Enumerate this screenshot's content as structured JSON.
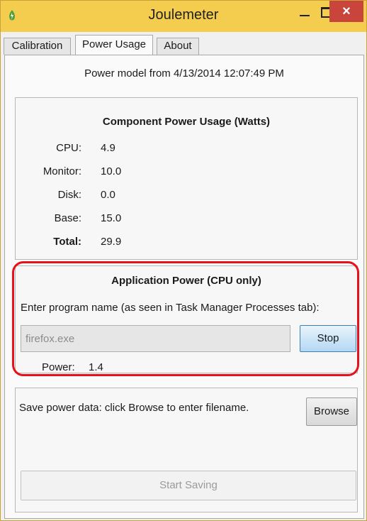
{
  "window": {
    "title": "Joulemeter",
    "close_glyph": "×",
    "title_bar_color": "#f5cd4e",
    "close_button_color": "#c9443b"
  },
  "tabs": [
    {
      "label": "Calibration",
      "active": false
    },
    {
      "label": "Power Usage",
      "active": true
    },
    {
      "label": "About",
      "active": false
    }
  ],
  "power_usage": {
    "model_line": "Power model from 4/13/2014 12:07:49 PM",
    "component": {
      "title": "Component Power Usage (Watts)",
      "rows": [
        {
          "label": "CPU:",
          "value": "4.9"
        },
        {
          "label": "Monitor:",
          "value": "10.0"
        },
        {
          "label": "Disk:",
          "value": "0.0"
        },
        {
          "label": "Base:",
          "value": "15.0"
        },
        {
          "label": "Total:",
          "value": "29.9"
        }
      ]
    },
    "application": {
      "title": "Application Power (CPU only)",
      "prompt": "Enter program name (as seen in Task Manager Processes tab):",
      "program_value": "firefox.exe",
      "stop_label": "Stop",
      "power_label": "Power:",
      "power_value": "1.4",
      "highlight_color": "#e8101a"
    },
    "save": {
      "instruction": "Save power data: click Browse to enter filename.",
      "browse_label": "Browse",
      "start_label": "Start Saving"
    }
  },
  "icons": {
    "app": "joulemeter-app-icon",
    "minimize": "minimize-icon",
    "maximize": "maximize-icon",
    "close": "close-icon"
  }
}
